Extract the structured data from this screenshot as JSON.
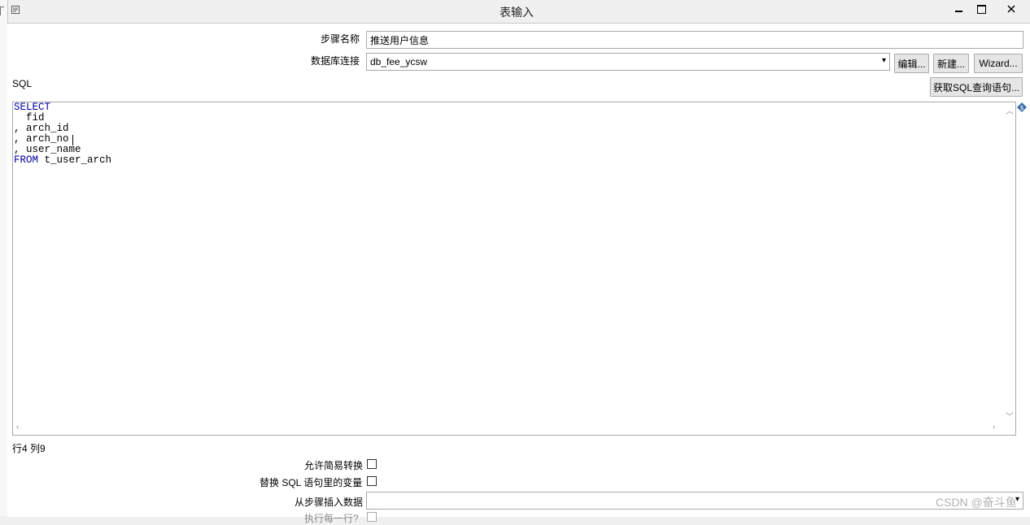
{
  "window": {
    "title": "表输入",
    "minimize_glyph": "—",
    "maximize_glyph": "☐",
    "close_glyph": "✕"
  },
  "form": {
    "step_name_label": "步骤名称",
    "step_name_value": "推送用户信息",
    "db_conn_label": "数据库连接",
    "db_conn_value": "db_fee_ycsw",
    "edit_button": "编辑...",
    "new_button": "新建...",
    "wizard_button": "Wizard...",
    "sql_label": "SQL",
    "get_sql_button": "获取SQL查询语句..."
  },
  "sql_editor": {
    "lines": [
      {
        "keyword": "SELECT",
        "text": ""
      },
      {
        "keyword": "",
        "text": "  fid"
      },
      {
        "keyword": "",
        "text": ", arch_id"
      },
      {
        "keyword": "",
        "text": ", arch_no"
      },
      {
        "keyword": "",
        "text": ", user_name"
      },
      {
        "keyword": "FROM",
        "text": " t_user_arch"
      }
    ],
    "cursor_position": "行4 列9"
  },
  "options": {
    "lazy_conversion_label": "允许简易转换",
    "replace_variables_label": "替换 SQL 语句里的变量",
    "insert_from_step_label": "从步骤插入数据",
    "insert_from_step_value": "",
    "execute_each_row_label": "执行每一行?"
  },
  "watermark": "CSDN @奋斗鱼"
}
